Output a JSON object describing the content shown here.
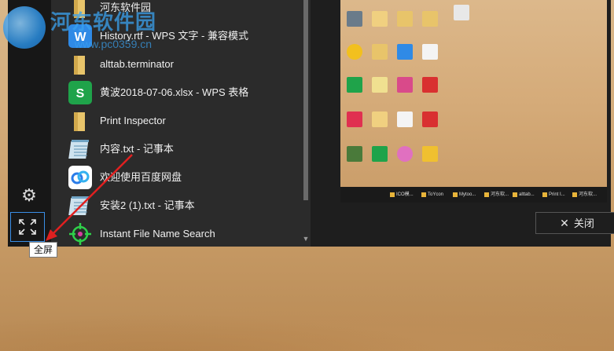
{
  "watermark": {
    "title": "河东软件园",
    "url": "www.pc0359.cn"
  },
  "apps": [
    {
      "label": "河东软件园",
      "icon": "folder-icon"
    },
    {
      "label": "History.rtf - WPS 文字 - 兼容模式",
      "icon": "wps-writer-icon"
    },
    {
      "label": "alttab.terminator",
      "icon": "folder-icon"
    },
    {
      "label": "黄波2018-07-06.xlsx - WPS 表格",
      "icon": "wps-spreadsheet-icon"
    },
    {
      "label": "Print Inspector",
      "icon": "folder-icon"
    },
    {
      "label": "内容.txt - 记事本",
      "icon": "notepad-icon"
    },
    {
      "label": "欢迎使用百度网盘",
      "icon": "baidu-netdisk-icon"
    },
    {
      "label": "安装2 (1).txt - 记事本",
      "icon": "notepad-icon"
    },
    {
      "label": "Instant File Name Search",
      "icon": "crosshair-icon"
    }
  ],
  "preview": {
    "taskbar_items": [
      "ICO模...",
      "ToYcon",
      "Mytoo...",
      "河东软...",
      "alttab...",
      "Print I...",
      "河东软..."
    ]
  },
  "close_button": {
    "label": "关闭"
  },
  "tooltip": {
    "text": "全屏"
  },
  "colors": {
    "accent": "#3a8ee6",
    "arrow": "#e02020"
  }
}
